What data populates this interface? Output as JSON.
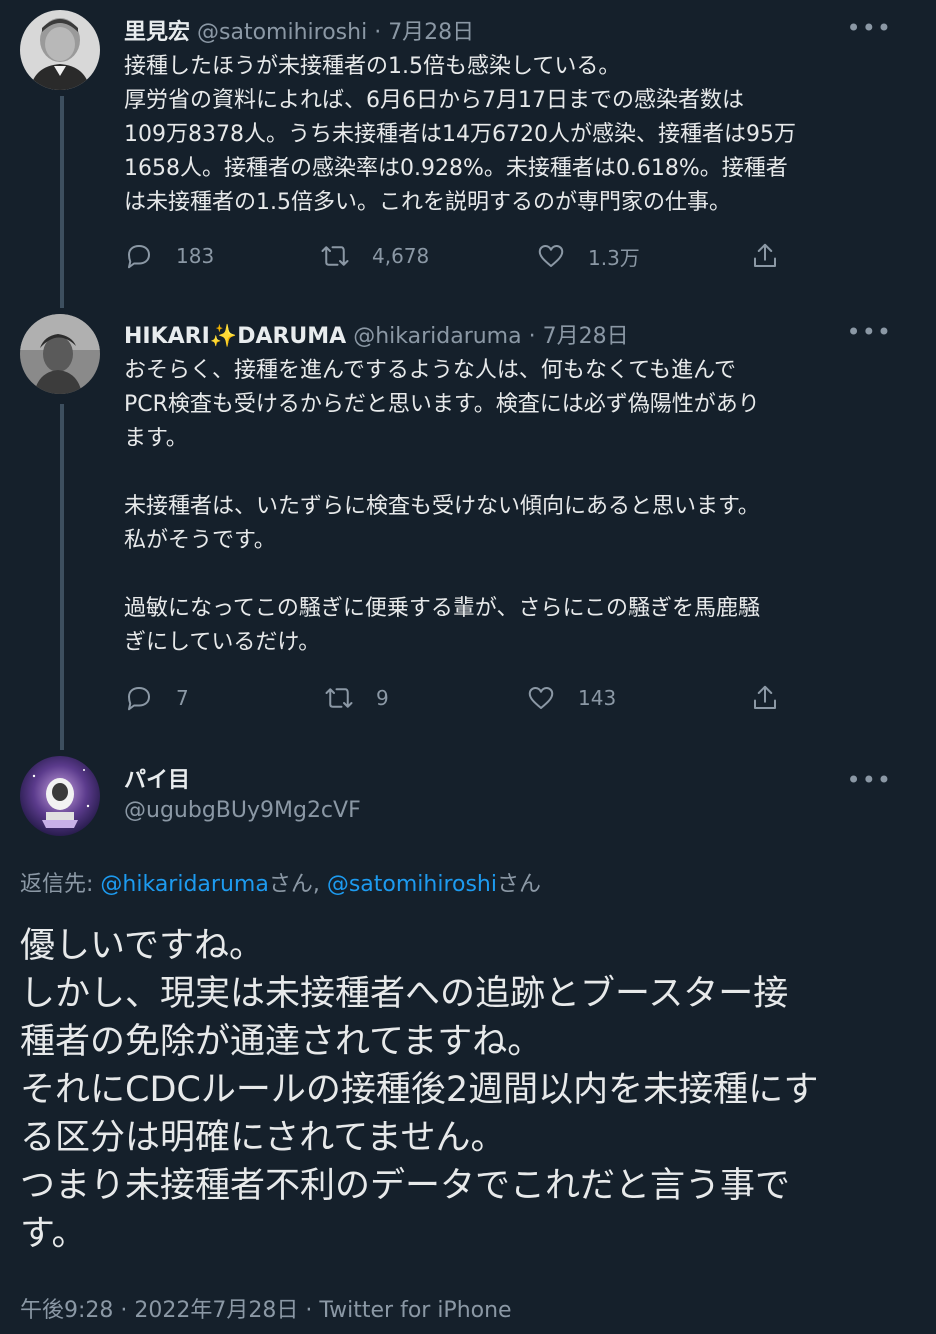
{
  "tweets": [
    {
      "name": "里見宏",
      "handle": "@satomihiroshi",
      "date": "7月28日",
      "text": "接種したほうが未接種者の1.5倍も感染している。\n厚労省の資料によれば、6月6日から7月17日までの感染者数は\n109万8378人。うち未接種者は14万6720人が感染、接種者は95万\n1658人。接種者の感染率は0.928%。未接種者は0.618%。接種者\nは未接種者の1.5倍多い。これを説明するのが専門家の仕事。",
      "replies": "183",
      "retweets": "4,678",
      "likes": "1.3万"
    },
    {
      "name": "HIKARI✨DARUMA",
      "handle": "@hikaridaruma",
      "date": "7月28日",
      "text": "おそらく、接種を進んでするような人は、何もなくても進んで\nPCR検査も受けるからだと思います。検査には必ず偽陽性があり\nます。\n\n未接種者は、いたずらに検査も受けない傾向にあると思います。\n私がそうです。\n\n過敏になってこの騒ぎに便乗する輩が、さらにこの騒ぎを馬鹿騒\nぎにしているだけ。",
      "replies": "7",
      "retweets": "9",
      "likes": "143"
    }
  ],
  "main": {
    "name": "パイ目",
    "handle": "@ugubgBUy9Mg2cVF",
    "reply_prefix": "返信先: ",
    "reply_user1": "@hikaridaruma",
    "reply_san1": "さん, ",
    "reply_user2": "@satomihiroshi",
    "reply_san2": "さん",
    "text": "優しいですね。\nしかし、現実は未接種者への追跡とブースター接\n種者の免除が通達されてますね。\nそれにCDCルールの接種後2週間以内を未接種にす\nる区分は明確にされてません。\nつまり未接種者不利のデータでこれだと言う事で\nす。",
    "timestamp": "午後9:28 · 2022年7月28日 · Twitter for iPhone"
  },
  "more_label": "•••",
  "colors": {
    "background": "#15202b",
    "text": "#e7e9ea",
    "muted": "#8b98a5",
    "link": "#1d9bf0",
    "thread_line": "#3d4f5f"
  },
  "icons": [
    "reply-icon",
    "retweet-icon",
    "like-icon",
    "share-icon",
    "more-icon"
  ]
}
